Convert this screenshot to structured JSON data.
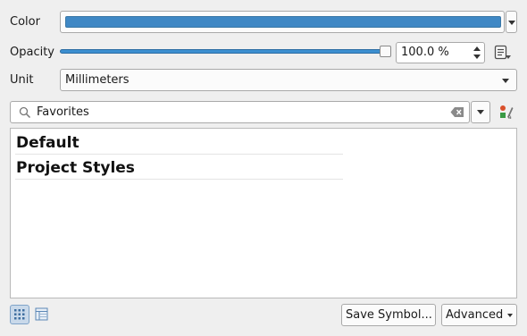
{
  "color": {
    "label": "Color",
    "value_hex": "#3f88c5"
  },
  "opacity": {
    "label": "Opacity",
    "slider_fraction": 1.0,
    "value_text": "100.0 %",
    "data_defined_icon": "data-defined-override-icon"
  },
  "unit": {
    "label": "Unit",
    "selected": "Millimeters"
  },
  "search": {
    "value": "Favorites",
    "search_icon": "search-icon",
    "clear_icon": "clear-text-icon",
    "style_manager_icon": "style-manager-icon"
  },
  "symbol_list": {
    "groups": [
      {
        "label": "Default"
      },
      {
        "label": "Project Styles"
      }
    ]
  },
  "footer": {
    "icon_view_icon": "icon-view-icon",
    "list_view_icon": "list-view-icon",
    "save_symbol_label": "Save Symbol...",
    "advanced_label": "Advanced"
  },
  "colors": {
    "background": "#efefef",
    "accent": "#3c8fd0"
  }
}
